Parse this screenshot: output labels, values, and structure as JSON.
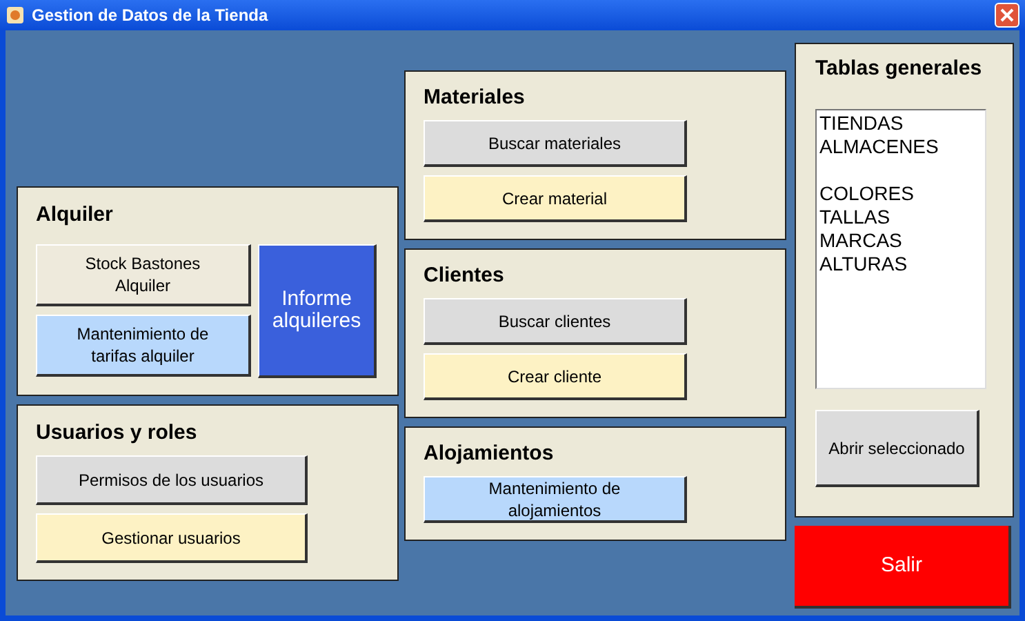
{
  "window": {
    "title": "Gestion de Datos de la Tienda"
  },
  "columns": [
    {
      "sections": [
        {
          "title": "Alquiler",
          "buttons": [
            {
              "label": "Stock Bastones Alquiler",
              "color": "#eeeadc",
              "kind": "wide"
            },
            {
              "label": "Mantenimiento de tarifas alquiler",
              "color": "#b8d8fc",
              "kind": "wide"
            },
            {
              "label": "Informe alquileres",
              "color": "#3a60dc",
              "kind": "tall"
            }
          ]
        },
        {
          "title": "Usuarios y roles",
          "buttons": [
            {
              "label": "Permisos de los usuarios",
              "color": "#dcdcdc",
              "kind": "wide"
            },
            {
              "label": "Gestionar usuarios",
              "color": "#fdf2c4",
              "kind": "wide"
            }
          ]
        }
      ]
    },
    {
      "sections": [
        {
          "title": "Materiales",
          "buttons": [
            {
              "label": "Buscar materiales",
              "color": "#dcdcdc",
              "kind": "wide"
            },
            {
              "label": "Crear material",
              "color": "#fdf2c4",
              "kind": "wide"
            }
          ]
        },
        {
          "title": "Clientes",
          "buttons": [
            {
              "label": "Buscar clientes",
              "color": "#dcdcdc",
              "kind": "wide"
            },
            {
              "label": "Crear cliente",
              "color": "#fdf2c4",
              "kind": "wide"
            }
          ]
        },
        {
          "title": "Alojamientos",
          "buttons": [
            {
              "label": "Mantenimiento de alojamientos",
              "color": "#b8d8fc",
              "kind": "wide"
            }
          ]
        }
      ]
    }
  ],
  "tables": {
    "title": "Tablas generales",
    "groups": [
      [
        "TIENDAS",
        "ALMACENES"
      ],
      [
        "COLORES",
        "TALLAS",
        "MARCAS",
        "ALTURAS"
      ]
    ],
    "open_button": "Abrir seleccionado"
  },
  "exit_button": "Salir"
}
